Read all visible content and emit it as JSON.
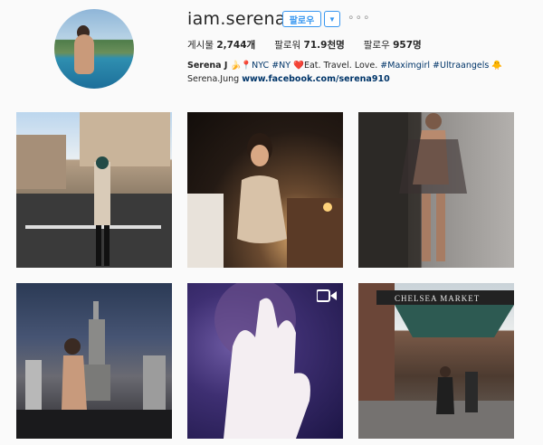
{
  "profile": {
    "username": "iam.serena",
    "follow_label": "팔로우",
    "dropdown_icon": "chevron-down-icon",
    "more_icon": "more-dots-icon",
    "more_label": "∘∘∘"
  },
  "stats": {
    "posts_label": "게시물",
    "posts_value": "2,744개",
    "followers_label": "팔로워",
    "followers_value": "71.9천명",
    "following_label": "팔로우",
    "following_value": "957명"
  },
  "bio": {
    "name": "Serena J",
    "emoji_banana": "🍌",
    "pin": "📍",
    "part1": "NYC #NY",
    "heart": "❤️",
    "part2": "Eat. Travel. Love.",
    "tag1": "#Maximgirl",
    "tag2": "#Ultraangels",
    "emoji_end": "🐥",
    "line2_text": "Serena.Jung",
    "link": "www.facebook.com/serena910"
  },
  "posts": [
    {
      "id": "post-1",
      "kind": "photo"
    },
    {
      "id": "post-2",
      "kind": "photo"
    },
    {
      "id": "post-3",
      "kind": "photo"
    },
    {
      "id": "post-4",
      "kind": "photo"
    },
    {
      "id": "post-5",
      "kind": "video",
      "icon": "video-camera-icon"
    },
    {
      "id": "post-6",
      "kind": "photo",
      "sign_text": "CHELSEA MARKET"
    }
  ],
  "colors": {
    "accent": "#3897f0",
    "link": "#003569",
    "heart": "#e0245e",
    "background": "#fafafa"
  }
}
